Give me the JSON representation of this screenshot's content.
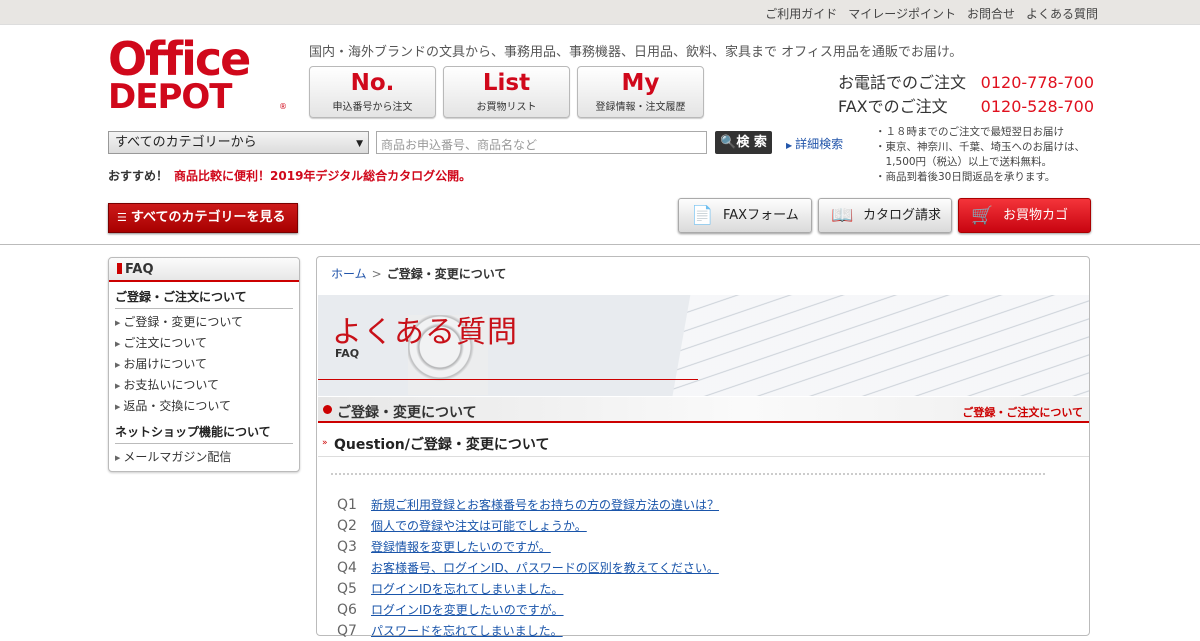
{
  "top_links": [
    "ご利用ガイド",
    "マイレージポイント",
    "お問合せ",
    "よくある質問"
  ],
  "logo": {
    "line1": "Office",
    "line2": "DEPOT",
    "reg": "®"
  },
  "tagline": "国内・海外ブランドの文具から、事務用品、事務機器、日用品、飲料、家具まで オフィス用品を通販でお届け。",
  "big_buttons": [
    {
      "big": "No.",
      "small": "申込番号から注文"
    },
    {
      "big": "List",
      "small": "お買物リスト"
    },
    {
      "big": "My",
      "small": "登録情報・注文履歴"
    }
  ],
  "contact": {
    "phone_label": "お電話でのご注文",
    "phone_number": "0120-778-700",
    "fax_label": "FAXでのご注文",
    "fax_number": "0120-528-700"
  },
  "search": {
    "category_selected": "すべてのカテゴリーから",
    "placeholder": "商品お申込番号、商品名など",
    "button_label": "検 索",
    "detail_link": "詳細検索"
  },
  "notes": [
    "・１８時までのご注文で最短翌日お届け",
    "・東京、神奈川、千葉、埼玉へのお届けは、",
    "　1,500円（税込）以上で送料無料。",
    "・商品到着後30日間返品を承ります。"
  ],
  "recommend": {
    "label": "おすすめ！",
    "link": "商品比較に便利！2019年デジタル総合カタログ公開。"
  },
  "all_categories_button": "すべてのカテゴリーを見る",
  "right_buttons": {
    "fax": "FAXフォーム",
    "catalog": "カタログ請求",
    "cart": "お買物カゴ"
  },
  "sidebar": {
    "title": "FAQ",
    "section1": "ご登録・ご注文について",
    "items1": [
      "ご登録・変更について",
      "ご注文について",
      "お届けについて",
      "お支払いについて",
      "返品・交換について"
    ],
    "section2": "ネットショップ機能について",
    "items2": [
      "メールマガジン配信"
    ]
  },
  "breadcrumb": {
    "home": "ホーム",
    "sep": ">",
    "current": "ご登録・変更について"
  },
  "banner": {
    "title": "よくある質問",
    "subtitle": "FAQ"
  },
  "section": {
    "title": "ご登録・変更について",
    "right_link": "ご登録・ご注文について"
  },
  "question_header": "Question/ご登録・変更について",
  "questions": [
    {
      "num": "Q1",
      "text": "新規ご利用登録とお客様番号をお持ちの方の登録方法の違いは？"
    },
    {
      "num": "Q2",
      "text": "個人での登録や注文は可能でしょうか。"
    },
    {
      "num": "Q3",
      "text": "登録情報を変更したいのですが。"
    },
    {
      "num": "Q4",
      "text": "お客様番号、ログインID、パスワードの区別を教えてください。"
    },
    {
      "num": "Q5",
      "text": "ログインIDを忘れてしまいました。"
    },
    {
      "num": "Q6",
      "text": "ログインIDを変更したいのですが。"
    },
    {
      "num": "Q7",
      "text": "パスワードを忘れてしまいました。"
    }
  ]
}
